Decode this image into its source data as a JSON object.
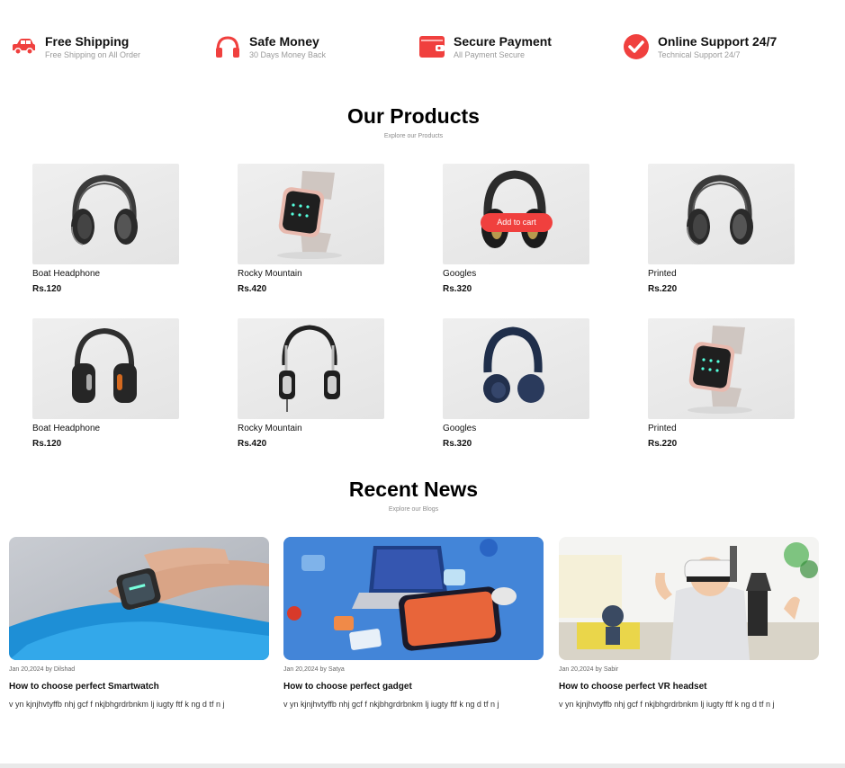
{
  "features": [
    {
      "title": "Free Shipping",
      "subtitle": "Free Shipping on All Order",
      "icon": "car-icon"
    },
    {
      "title": "Safe Money",
      "subtitle": "30 Days Money Back",
      "icon": "headphones-icon"
    },
    {
      "title": "Secure Payment",
      "subtitle": "All Payment Secure",
      "icon": "wallet-icon"
    },
    {
      "title": "Online Support 24/7",
      "subtitle": "Technical Support 24/7",
      "icon": "check-circle-icon"
    }
  ],
  "accent_color": "#f0403e",
  "products_section": {
    "title": "Our Products",
    "subtitle": "Explore our Products"
  },
  "products": [
    {
      "name": "Boat Headphone",
      "price": "Rs.120",
      "image": "headphone-black"
    },
    {
      "name": "Rocky Mountain",
      "price": "Rs.420",
      "image": "smartwatch-pink"
    },
    {
      "name": "Googles",
      "price": "Rs.320",
      "image": "headphone-gold"
    },
    {
      "name": "Printed",
      "price": "Rs.220",
      "image": "headphone-black"
    },
    {
      "name": "Boat Headphone",
      "price": "Rs.120",
      "image": "headphone-orange"
    },
    {
      "name": "Rocky Mountain",
      "price": "Rs.420",
      "image": "headphone-silver"
    },
    {
      "name": "Googles",
      "price": "Rs.320",
      "image": "headphone-navy"
    },
    {
      "name": "Printed",
      "price": "Rs.220",
      "image": "smartwatch-pink"
    }
  ],
  "add_to_cart_label": "Add to cart",
  "news_section": {
    "title": "Recent News",
    "subtitle": "Explore our Blogs"
  },
  "news": [
    {
      "meta": "Jan 20,2024 by Dilshad",
      "title": "How to choose perfect Smartwatch",
      "body": "v yn kjnjhvtyffb nhj gcf f nkjbhgrdrbnkm lj iugty ftf k ng d tf n j",
      "image": "smartwatch-wrist"
    },
    {
      "meta": "Jan 20,2024 by Satya",
      "title": "How to choose perfect gadget",
      "body": "v yn kjnjhvtyffb nhj gcf f nkjbhgrdrbnkm lj iugty ftf k ng d tf n j",
      "image": "gadgets-desk"
    },
    {
      "meta": "Jan 20,2024 by Sabir",
      "title": "How to choose perfect VR headset",
      "body": "v yn kjnjhvtyffb nhj gcf f nkjbhgrdrbnkm lj iugty ftf k ng d tf n j",
      "image": "vr-kid"
    }
  ]
}
